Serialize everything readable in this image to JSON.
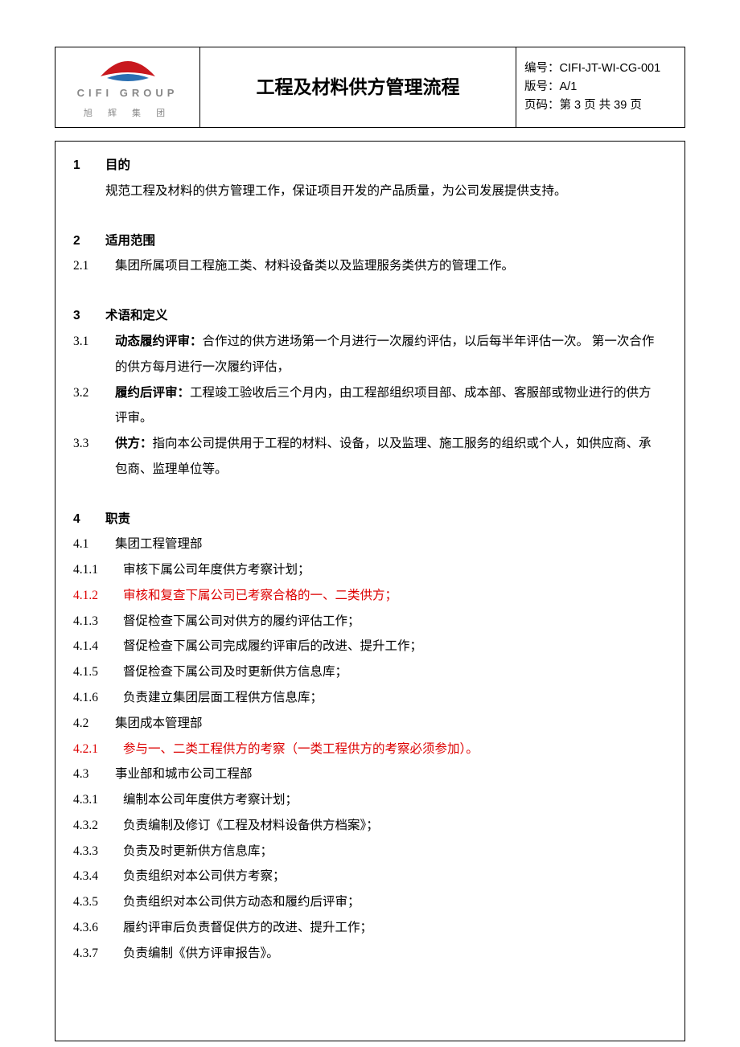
{
  "header": {
    "logo_en": "CIFI GROUP",
    "logo_cn": "旭 辉 集 团",
    "title": "工程及材料供方管理流程",
    "meta_code": "编号：CIFI-JT-WI-CG-001",
    "meta_version": "版号：A/1",
    "meta_page": "页码：第 3 页 共 39 页"
  },
  "s1": {
    "num": "1",
    "title": "目的",
    "body": "规范工程及材料的供方管理工作，保证项目开发的产品质量，为公司发展提供支持。"
  },
  "s2": {
    "num": "2",
    "title": "适用范围",
    "i1_num": "2.1",
    "i1_txt": "集团所属项目工程施工类、材料设备类以及监理服务类供方的管理工作。"
  },
  "s3": {
    "num": "3",
    "title": "术语和定义",
    "i1_num": "3.1",
    "i1_term": "动态履约评审：",
    "i1_txt": "合作过的供方进场第一个月进行一次履约评估，以后每半年评估一次。 第一次合作的供方每月进行一次履约评估，",
    "i2_num": "3.2",
    "i2_term": "履约后评审：",
    "i2_txt": "工程竣工验收后三个月内，由工程部组织项目部、成本部、客服部或物业进行的供方评审。",
    "i3_num": "3.3",
    "i3_term": "供方：",
    "i3_txt": "指向本公司提供用于工程的材料、设备，以及监理、施工服务的组织或个人，如供应商、承包商、监理单位等。"
  },
  "s4": {
    "num": "4",
    "title": "职责",
    "g1_num": "4.1",
    "g1_txt": "集团工程管理部",
    "g1_1_num": "4.1.1",
    "g1_1_txt": "审核下属公司年度供方考察计划；",
    "g1_2_num": "4.1.2",
    "g1_2_txt": "审核和复查下属公司已考察合格的一、二类供方；",
    "g1_3_num": "4.1.3",
    "g1_3_txt": "督促检查下属公司对供方的履约评估工作；",
    "g1_4_num": "4.1.4",
    "g1_4_txt": "督促检查下属公司完成履约评审后的改进、提升工作；",
    "g1_5_num": "4.1.5",
    "g1_5_txt": "督促检查下属公司及时更新供方信息库；",
    "g1_6_num": "4.1.6",
    "g1_6_txt": "负责建立集团层面工程供方信息库；",
    "g2_num": "4.2",
    "g2_txt": "集团成本管理部",
    "g2_1_num": "4.2.1",
    "g2_1_txt": "参与一、二类工程供方的考察（一类工程供方的考察必须参加）。",
    "g3_num": "4.3",
    "g3_txt": "事业部和城市公司工程部",
    "g3_1_num": "4.3.1",
    "g3_1_txt": "编制本公司年度供方考察计划；",
    "g3_2_num": "4.3.2",
    "g3_2_txt": "负责编制及修订《工程及材料设备供方档案》；",
    "g3_3_num": "4.3.3",
    "g3_3_txt": "负责及时更新供方信息库；",
    "g3_4_num": "4.3.4",
    "g3_4_txt": "负责组织对本公司供方考察；",
    "g3_5_num": "4.3.5",
    "g3_5_txt": "负责组织对本公司供方动态和履约后评审；",
    "g3_6_num": "4.3.6",
    "g3_6_txt": "履约评审后负责督促供方的改进、提升工作；",
    "g3_7_num": "4.3.7",
    "g3_7_txt": "负责编制《供方评审报告》。"
  }
}
